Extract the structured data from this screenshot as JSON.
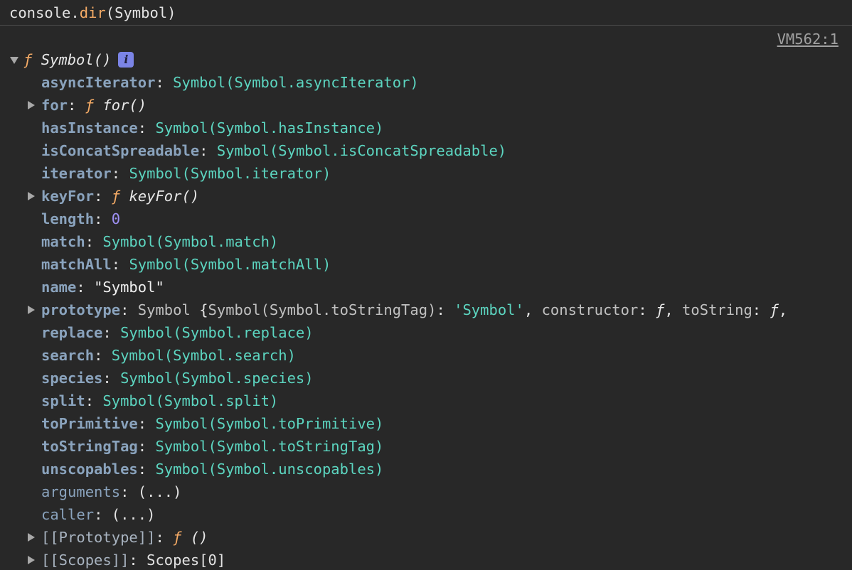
{
  "input": {
    "object": "console",
    "dot": ".",
    "method": "dir",
    "args": "(Symbol)"
  },
  "source_link": "VM562:1",
  "root": {
    "f": "ƒ",
    "name": "Symbol()",
    "info_glyph": "i"
  },
  "props": {
    "asyncIterator": {
      "key": "asyncIterator",
      "value": "Symbol(Symbol.asyncIterator)"
    },
    "for": {
      "key": "for",
      "f": "ƒ",
      "value": "for()"
    },
    "hasInstance": {
      "key": "hasInstance",
      "value": "Symbol(Symbol.hasInstance)"
    },
    "isConcatSpreadable": {
      "key": "isConcatSpreadable",
      "value": "Symbol(Symbol.isConcatSpreadable)"
    },
    "iterator": {
      "key": "iterator",
      "value": "Symbol(Symbol.iterator)"
    },
    "keyFor": {
      "key": "keyFor",
      "f": "ƒ",
      "value": "keyFor()"
    },
    "length": {
      "key": "length",
      "value": "0"
    },
    "match": {
      "key": "match",
      "value": "Symbol(Symbol.match)"
    },
    "matchAll": {
      "key": "matchAll",
      "value": "Symbol(Symbol.matchAll)"
    },
    "name": {
      "key": "name",
      "value": "\"Symbol\""
    },
    "prototype": {
      "key": "prototype",
      "class": "Symbol",
      "open": "{",
      "inner_key": "Symbol(Symbol.toStringTag)",
      "inner_value": "'Symbol'",
      "constructor_key": "constructor",
      "constructor_value": "ƒ",
      "toString_key": "toString",
      "toString_value": "ƒ"
    },
    "replace": {
      "key": "replace",
      "value": "Symbol(Symbol.replace)"
    },
    "search": {
      "key": "search",
      "value": "Symbol(Symbol.search)"
    },
    "species": {
      "key": "species",
      "value": "Symbol(Symbol.species)"
    },
    "split": {
      "key": "split",
      "value": "Symbol(Symbol.split)"
    },
    "toPrimitive": {
      "key": "toPrimitive",
      "value": "Symbol(Symbol.toPrimitive)"
    },
    "toStringTag": {
      "key": "toStringTag",
      "value": "Symbol(Symbol.toStringTag)"
    },
    "unscopables": {
      "key": "unscopables",
      "value": "Symbol(Symbol.unscopables)"
    },
    "arguments": {
      "key": "arguments",
      "value": "(...)"
    },
    "caller": {
      "key": "caller",
      "value": "(...)"
    },
    "proto": {
      "key": "[[Prototype]]",
      "f": "ƒ",
      "value": "()"
    },
    "scopes": {
      "key": "[[Scopes]]",
      "value": "Scopes[0]"
    }
  }
}
